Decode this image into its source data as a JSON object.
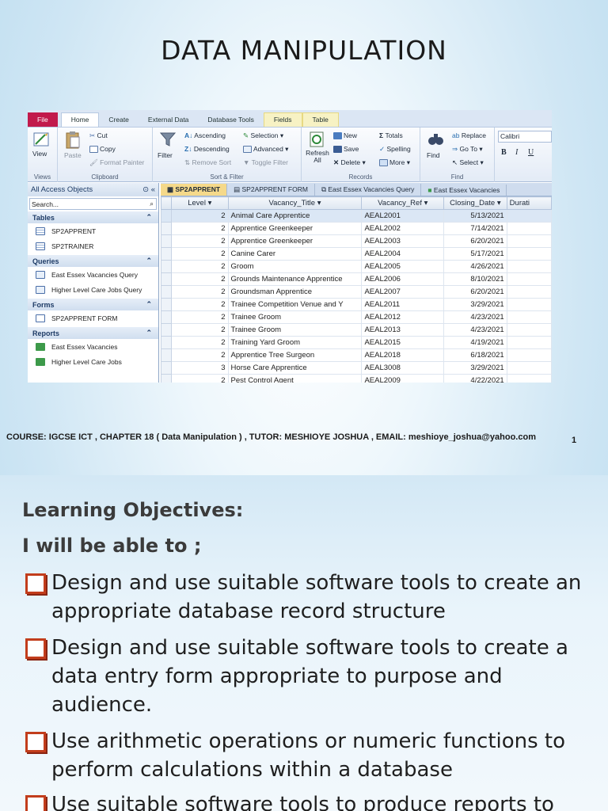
{
  "slide1": {
    "title": "DATA MANIPULATION",
    "footer": "COURSE: IGCSE ICT , CHAPTER 18 ( Data Manipulation ) , TUTOR: MESHIOYE JOSHUA , EMAIL: meshioye_joshua@yahoo.com",
    "page_number": "1"
  },
  "access": {
    "tabs": [
      "File",
      "Home",
      "Create",
      "External Data",
      "Database Tools",
      "Fields",
      "Table"
    ],
    "views_group": {
      "view_label": "View",
      "label": "Views"
    },
    "clipboard_group": {
      "paste": "Paste",
      "cut": "Cut",
      "copy": "Copy",
      "format_painter": "Format Painter",
      "label": "Clipboard"
    },
    "sort_group": {
      "filter": "Filter",
      "ascending": "Ascending",
      "descending": "Descending",
      "remove_sort": "Remove Sort",
      "selection": "Selection",
      "advanced": "Advanced",
      "toggle_filter": "Toggle Filter",
      "label": "Sort & Filter"
    },
    "records_group": {
      "refresh": "Refresh All",
      "new": "New",
      "save": "Save",
      "delete": "Delete",
      "totals": "Totals",
      "spelling": "Spelling",
      "more": "More",
      "label": "Records"
    },
    "find_group": {
      "find": "Find",
      "replace": "Replace",
      "goto": "Go To",
      "select": "Select",
      "label": "Find"
    },
    "font_name": "Calibri",
    "nav": {
      "header": "All Access Objects",
      "search": "Search...",
      "sections": [
        {
          "name": "Tables",
          "items": [
            "SP2APPRENT",
            "SP2TRAINER"
          ]
        },
        {
          "name": "Queries",
          "items": [
            "East Essex Vacancies Query",
            "Higher Level Care Jobs Query"
          ]
        },
        {
          "name": "Forms",
          "items": [
            "SP2APPRENT FORM"
          ]
        },
        {
          "name": "Reports",
          "items": [
            "East Essex Vacancies",
            "Higher Level Care Jobs"
          ]
        }
      ]
    },
    "doc_tabs": [
      "SP2APPRENT",
      "SP2APPRENT FORM",
      "East Essex Vacancies Query",
      "East Essex Vacancies"
    ],
    "columns": [
      "Level",
      "Vacancy_Title",
      "Vacancy_Ref",
      "Closing_Date",
      "Durati"
    ],
    "rows": [
      [
        "2",
        "Animal Care Apprentice",
        "AEAL2001",
        "5/13/2021"
      ],
      [
        "2",
        "Apprentice Greenkeeper",
        "AEAL2002",
        "7/14/2021"
      ],
      [
        "2",
        "Apprentice Greenkeeper",
        "AEAL2003",
        "6/20/2021"
      ],
      [
        "2",
        "Canine Carer",
        "AEAL2004",
        "5/17/2021"
      ],
      [
        "2",
        "Groom",
        "AEAL2005",
        "4/26/2021"
      ],
      [
        "2",
        "Grounds Maintenance Apprentice",
        "AEAL2006",
        "8/10/2021"
      ],
      [
        "2",
        "Groundsman Apprentice",
        "AEAL2007",
        "6/20/2021"
      ],
      [
        "2",
        "Trainee Competition Venue and Y",
        "AEAL2011",
        "3/29/2021"
      ],
      [
        "2",
        "Trainee Groom",
        "AEAL2012",
        "4/23/2021"
      ],
      [
        "2",
        "Trainee Groom",
        "AEAL2013",
        "4/23/2021"
      ],
      [
        "2",
        "Training Yard Groom",
        "AEAL2015",
        "4/19/2021"
      ],
      [
        "2",
        "Apprentice Tree Surgeon",
        "AEAL2018",
        "6/18/2021"
      ],
      [
        "3",
        "Horse Care Apprentice",
        "AEAL3008",
        "3/29/2021"
      ],
      [
        "2",
        "Pest Control Agent",
        "AEAL2009",
        "4/22/2021"
      ]
    ]
  },
  "slide2": {
    "heading1": "Learning Objectives:",
    "heading2": "I will be able to ;",
    "bullets": [
      "Design and use suitable software tools to create an appropriate database record structure",
      "Design and use suitable software tools to create a data entry form appropriate to purpose and audience.",
      "Use arithmetic operations or numeric functions to perform calculations within a database",
      "Use suitable software tools to produce reports to"
    ]
  }
}
